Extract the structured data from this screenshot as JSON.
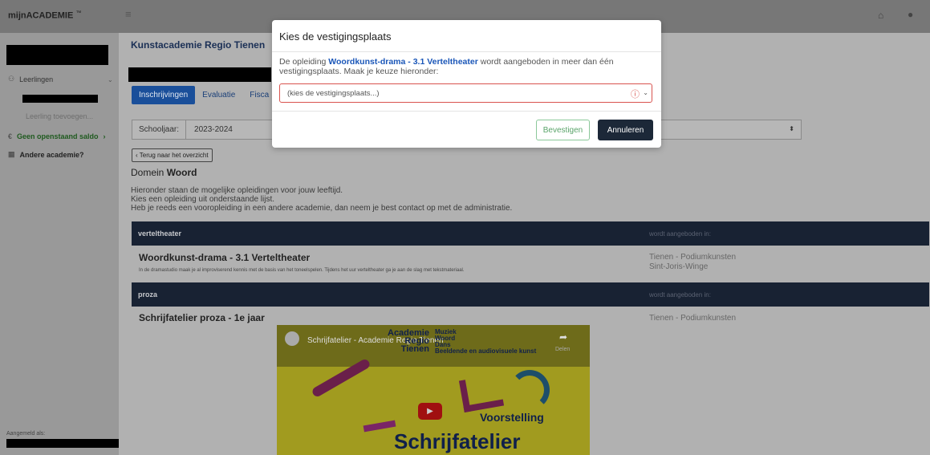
{
  "brand": {
    "name": "mijnACADEMIE",
    "tm": "™"
  },
  "header": {
    "menu_icon": "hamburger-icon",
    "home_icon": "home-icon",
    "user_icon": "user-icon"
  },
  "sidebar": {
    "students_label": "Leerlingen",
    "add_student": "Leerling toevoegen...",
    "balance_label": "Geen openstaand saldo",
    "other_academy": "Andere academie?",
    "logged_in_as": "Aangemeld als:"
  },
  "main": {
    "academy_title": "Kunstacademie Regio Tienen",
    "tabs": [
      {
        "label": "Inschrijvingen",
        "active": true
      },
      {
        "label": "Evaluatie"
      },
      {
        "label": "Fisca"
      }
    ],
    "school_year_label": "Schooljaar:",
    "school_year_value": "2023-2024",
    "back_button": "Terug naar het overzicht",
    "domain_prefix": "Domein ",
    "domain_name": "Woord",
    "intro_lines": [
      "Hieronder staan de mogelijke opleidingen voor jouw leeftijd.",
      "Kies een opleiding uit onderstaande lijst.",
      "Heb je reeds een vooropleiding in een andere academie, dan neem je best contact op met de administratie."
    ],
    "groups": [
      {
        "name": "verteltheater",
        "offered_label": "wordt aangeboden in:",
        "course_title": "Woordkunst-drama - 3.1 Verteltheater",
        "course_desc": "In de dramastudio maak je al improviserend kennis met de basis van het toneelspelen. Tijdens het uur verteltheater ga je aan de slag met tekstmateriaal.",
        "locations": [
          "Tienen - Podiumkunsten",
          "Sint-Joris-Winge"
        ]
      },
      {
        "name": "proza",
        "offered_label": "wordt aangeboden in:",
        "course_title": "Schrijfatelier proza - 1e jaar",
        "locations": [
          "Tienen - Podiumkunsten"
        ]
      }
    ],
    "video": {
      "title": "Schrijfatelier - Academie Regio Tienen",
      "share_label": "Delen",
      "academy_lines": [
        "Academie",
        "Regio",
        "Tienen"
      ],
      "disciplines": [
        "Muziek",
        "Woord",
        "Dans",
        "Beeldende en audiovisuele kunst"
      ],
      "performance": "Voorstelling",
      "big_title": "Schrijfatelier"
    }
  },
  "modal": {
    "title": "Kies de vestigingsplaats",
    "message_before": "De opleiding ",
    "message_link": "Woordkunst-drama - 3.1 Verteltheater",
    "message_after": " wordt aangeboden in meer dan één vestigingsplaats. Maak je keuze hieronder:",
    "select_placeholder": "(kies de vestigingsplaats...)",
    "confirm_label": "Bevestigen",
    "cancel_label": "Annuleren",
    "error_color": "#d9534f"
  }
}
